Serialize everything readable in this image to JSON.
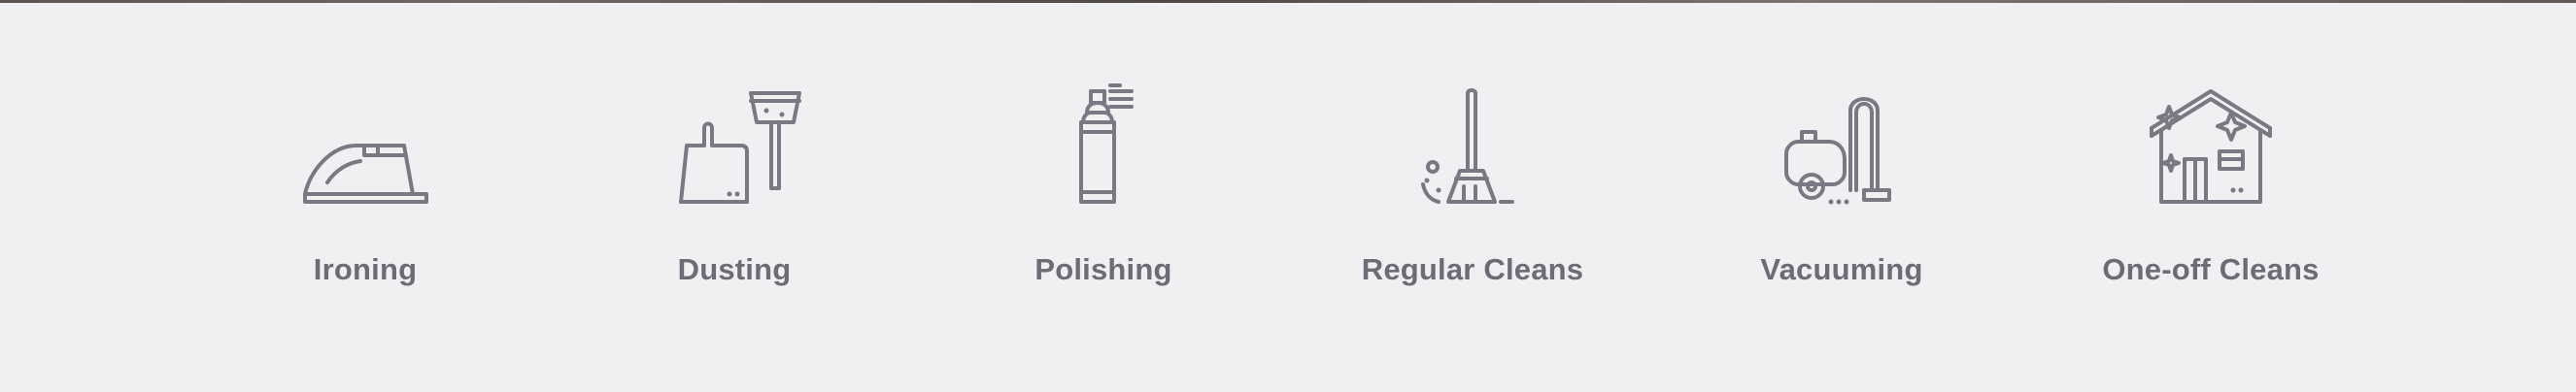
{
  "services": [
    {
      "label": "Ironing",
      "icon": "iron-icon"
    },
    {
      "label": "Dusting",
      "icon": "dustpan-brush-icon"
    },
    {
      "label": "Polishing",
      "icon": "spray-can-icon"
    },
    {
      "label": "Regular Cleans",
      "icon": "broom-icon"
    },
    {
      "label": "Vacuuming",
      "icon": "vacuum-cleaner-icon"
    },
    {
      "label": "One-off Cleans",
      "icon": "sparkling-house-icon"
    }
  ],
  "colors": {
    "background": "#f0f0f2",
    "icon": "#7b7884",
    "label": "#6e6b76"
  }
}
